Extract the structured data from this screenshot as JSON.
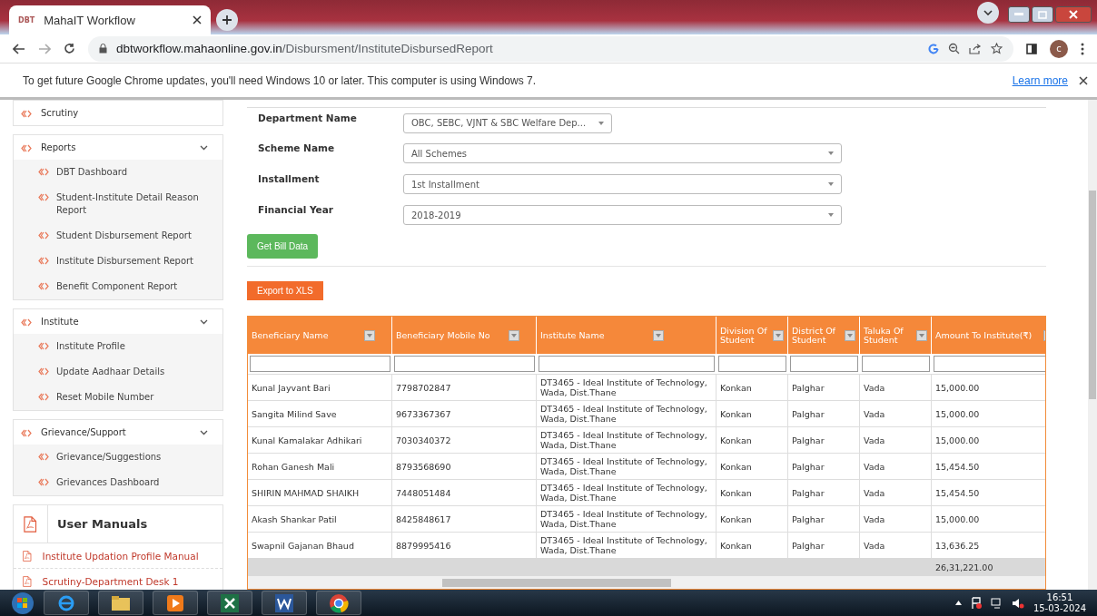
{
  "browser": {
    "tab_title": "MahaIT Workflow",
    "tab_logo": "DBT",
    "url_host": "dbtworkflow.mahaonline.gov.in",
    "url_path": "/Disbursment/InstituteDisbursedReport",
    "profile_initial": "c"
  },
  "infobar": {
    "message": "To get future Google Chrome updates, you'll need Windows 10 or later. This computer is using Windows 7.",
    "link": "Learn more"
  },
  "sidebar": {
    "groups": [
      {
        "label": "Scrutiny"
      },
      {
        "label": "Reports",
        "children": [
          "DBT Dashboard",
          "Student-Institute Detail Reason Report",
          "Student Disbursement Report",
          "Institute Disbursement Report",
          "Benefit Component Report"
        ]
      },
      {
        "label": "Institute",
        "children": [
          "Institute Profile",
          "Update Aadhaar Details",
          "Reset Mobile Number"
        ]
      },
      {
        "label": "Grievance/Support",
        "children": [
          "Grievance/Suggestions",
          "Grievances Dashboard"
        ]
      }
    ],
    "manuals": {
      "title": "User Manuals",
      "items": [
        "Institute Updation Profile Manual",
        "Scrutiny-Department Desk 1"
      ]
    }
  },
  "form": {
    "fields": [
      {
        "label": "Department Name",
        "value": "OBC, SEBC, VJNT & SBC Welfare Dep...",
        "kind": "short"
      },
      {
        "label": "Scheme Name",
        "value": "All Schemes",
        "kind": "wide"
      },
      {
        "label": "Installment",
        "value": "1st Installment",
        "kind": "wide"
      },
      {
        "label": "Financial Year",
        "value": "2018-2019",
        "kind": "wide"
      }
    ],
    "submit": "Get Bill Data",
    "export": "Export to XLS"
  },
  "table": {
    "columns": [
      "Beneficiary Name",
      "Beneficiary Mobile No",
      "Institute Name",
      "Division Of Student",
      "District Of Student",
      "Taluka Of Student",
      "Amount To Institute(₹)"
    ],
    "rows": [
      [
        "Kunal Jayvant Bari",
        "7798702847",
        "DT3465 - Ideal Institute of Technology, Wada, Dist.Thane",
        "Konkan",
        "Palghar",
        "Vada",
        "15,000.00"
      ],
      [
        "Sangita Milind Save",
        "9673367367",
        "DT3465 - Ideal Institute of Technology, Wada, Dist.Thane",
        "Konkan",
        "Palghar",
        "Vada",
        "15,000.00"
      ],
      [
        "Kunal Kamalakar Adhikari",
        "7030340372",
        "DT3465 - Ideal Institute of Technology, Wada, Dist.Thane",
        "Konkan",
        "Palghar",
        "Vada",
        "15,000.00"
      ],
      [
        "Rohan Ganesh Mali",
        "8793568690",
        "DT3465 - Ideal Institute of Technology, Wada, Dist.Thane",
        "Konkan",
        "Palghar",
        "Vada",
        "15,454.50"
      ],
      [
        "SHIRIN MAHMAD SHAIKH",
        "7448051484",
        "DT3465 - Ideal Institute of Technology, Wada, Dist.Thane",
        "Konkan",
        "Palghar",
        "Vada",
        "15,454.50"
      ],
      [
        "Akash Shankar Patil",
        "8425848617",
        "DT3465 - Ideal Institute of Technology, Wada, Dist.Thane",
        "Konkan",
        "Palghar",
        "Vada",
        "15,000.00"
      ],
      [
        "Swapnil Gajanan Bhaud",
        "8879995416",
        "DT3465 - Ideal Institute of Technology, Wada, Dist.Thane",
        "Konkan",
        "Palghar",
        "Vada",
        "13,636.25"
      ]
    ],
    "total": "26,31,221.00"
  },
  "taskbar": {
    "time": "16:51",
    "date": "15-03-2024"
  }
}
